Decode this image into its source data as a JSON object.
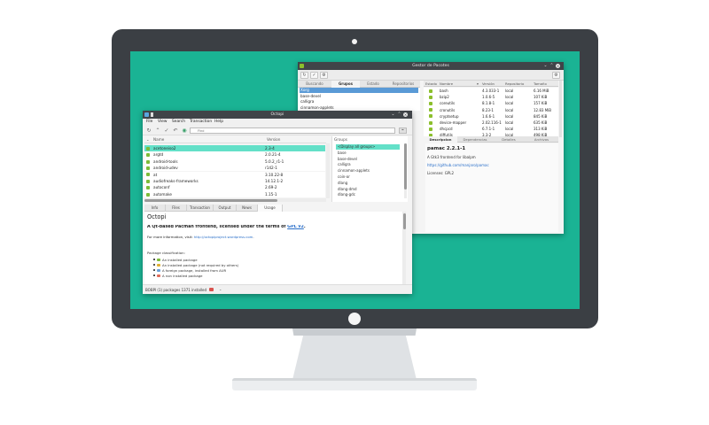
{
  "colors": {
    "screen_background": "#1ab394",
    "monitor_bezel": "#3b3f44",
    "selection_teal": "#63e0c8",
    "selection_blue": "#5a9ad6",
    "installed_green": "#7cbc3a"
  },
  "pamac": {
    "title": "Gestor de Pacotes",
    "toolbar_icons": [
      "refresh-icon",
      "apply-icon",
      "settings-icon"
    ],
    "tabs": [
      "Buscando",
      "Grupos",
      "Estado",
      "Repositorios"
    ],
    "active_tab": "Grupos",
    "groups": [
      "Xorg",
      "base-devel",
      "calligra",
      "cinnamon-applets"
    ],
    "columns": [
      "Estado",
      "Nombre",
      "Versión",
      "Repositorio",
      "Tamaño"
    ],
    "packages": [
      {
        "name": "bash",
        "version": "4.3.033-1",
        "repo": "local",
        "size": "6.16 MiB"
      },
      {
        "name": "bzip2",
        "version": "1.0.6-5",
        "repo": "local",
        "size": "107 KiB"
      },
      {
        "name": "coreutils",
        "version": "8.1.8-1",
        "repo": "local",
        "size": "157 KiB"
      },
      {
        "name": "cronutils",
        "version": "8.23-1",
        "repo": "local",
        "size": "12.83 MiB"
      },
      {
        "name": "cryptsetup",
        "version": "1.6.6-1",
        "repo": "local",
        "size": "845 KiB"
      },
      {
        "name": "device-mapper",
        "version": "2.02.116-1",
        "repo": "local",
        "size": "635 KiB"
      },
      {
        "name": "dhcpcd",
        "version": "6.7.1-1",
        "repo": "local",
        "size": "313 KiB"
      },
      {
        "name": "diffutils",
        "version": "3.3-2",
        "repo": "local",
        "size": "498 KiB"
      }
    ],
    "detail_tabs": [
      "Descripcion",
      "Dependencias",
      "Detalles",
      "Archivos"
    ],
    "detail": {
      "title": "pamac  2.2.1-1",
      "summary": "A Gtk3 frontend for libalpm",
      "url": "https://github.com/manjaro/pamac",
      "license": "Licenses: GPL2"
    }
  },
  "octopi": {
    "title": "Octopi",
    "menu": [
      "File",
      "View",
      "Search",
      "Transaction",
      "Help"
    ],
    "search_placeholder": "Find",
    "columns": [
      "Name",
      "Version"
    ],
    "packages": [
      {
        "name": "acetoneiso2",
        "version": "2.3-4"
      },
      {
        "name": "argtd",
        "version": "2.0.21-4"
      },
      {
        "name": "android-tools",
        "version": "5.0.2_r1-1"
      },
      {
        "name": "android-udev",
        "version": "r142-1"
      },
      {
        "name": "at",
        "version": "3.10.22-8"
      },
      {
        "name": "audiofreaks-frameworks",
        "version": "14.12.1-2"
      },
      {
        "name": "autoconf",
        "version": "2.69-2"
      },
      {
        "name": "automake",
        "version": "1.15-1"
      }
    ],
    "groups_header": "Groups",
    "groups": [
      "<Display all groups>",
      "base",
      "base-devel",
      "calligra",
      "cinnamon-applets",
      "coin-or",
      "dlang",
      "dlang-dmd",
      "dlang-gdc"
    ],
    "tabs": [
      "Info",
      "Files",
      "Transaction",
      "Output",
      "News",
      "Usage"
    ],
    "active_tab": "Usage",
    "info": {
      "heading": "Octopi",
      "tagline_pre": "A Qt-based Pacman frontend, licensed under the terms of ",
      "license_link": "GPL v2",
      "tagline_post": ".",
      "more_label": "For more information, visit: ",
      "more_link": "http://octopiproject.wordpress.com",
      "more_suffix": ".",
      "classification_title": "Package classification:",
      "classification": [
        "An installed package",
        "An installed package (not required by others)",
        "A foreign package, installed from AUR",
        "A non installed package"
      ]
    },
    "status_text": "BOBPI (1) packages 1371 installed"
  }
}
